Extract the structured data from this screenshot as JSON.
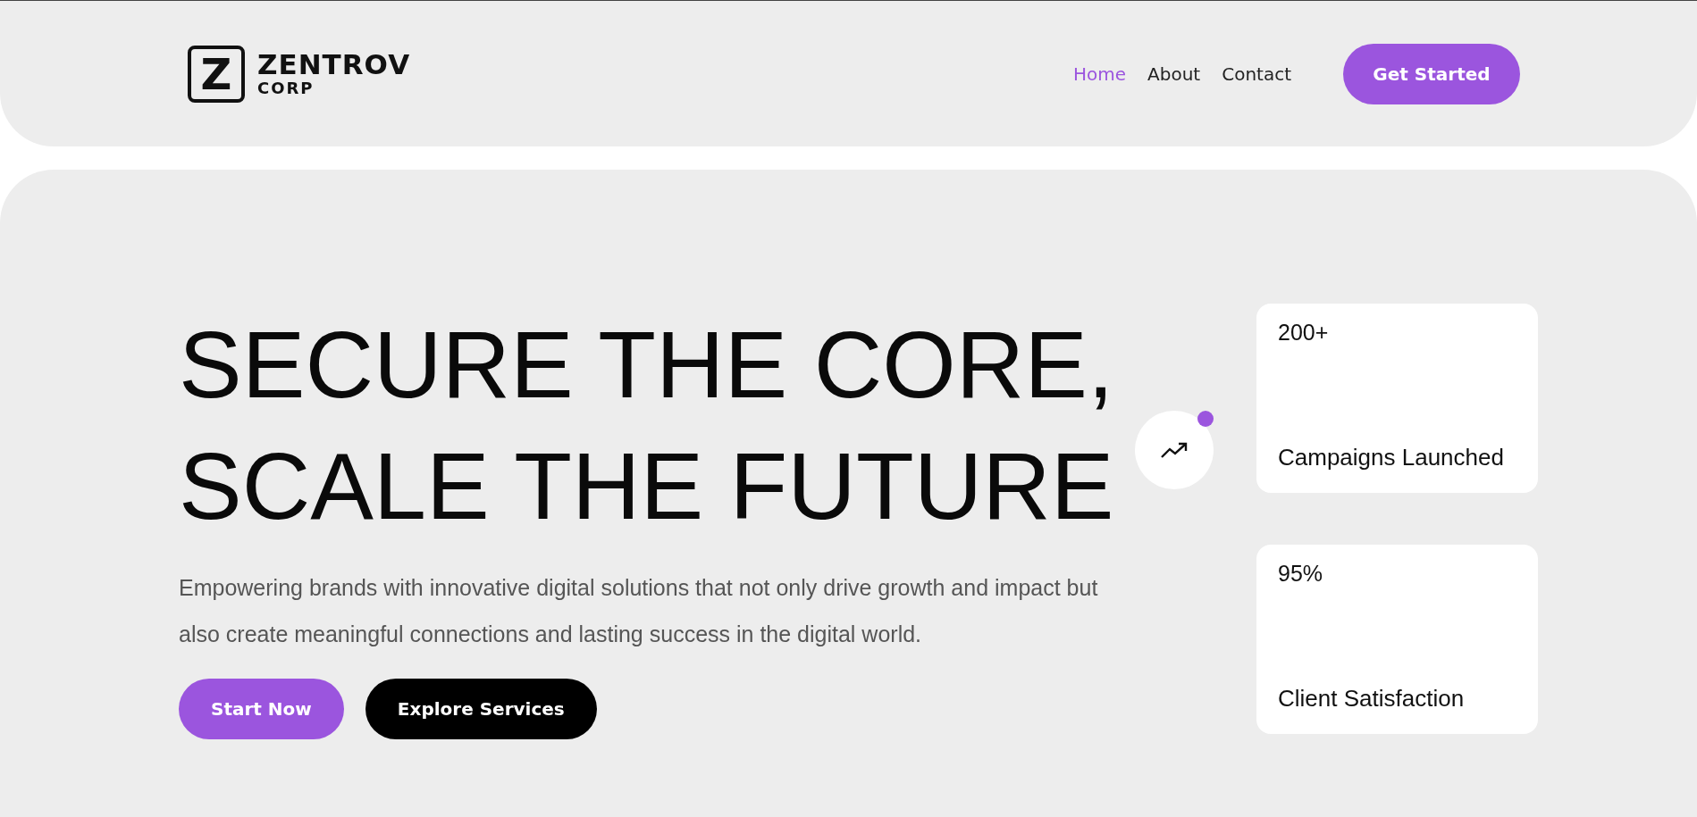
{
  "logo": {
    "letter": "Z",
    "name": "ZENTROV",
    "sub": "CORP"
  },
  "nav": [
    {
      "label": "Home",
      "selected": true
    },
    {
      "label": "About",
      "selected": false
    },
    {
      "label": "Contact",
      "selected": false
    }
  ],
  "cta": "Get Started",
  "hero": {
    "headline": [
      "SECURE THE CORE,",
      "SCALE THE FUTURE"
    ],
    "text": "Empowering brands with innovative digital solutions that not only drive growth and impact but also create meaningful connections and lasting success in the digital world.",
    "buttons": [
      {
        "label": "Start Now",
        "kind": "primary"
      },
      {
        "label": "Explore Services",
        "kind": "dark"
      }
    ]
  },
  "stats": [
    {
      "value": "200+",
      "label": "Campaigns Launched"
    },
    {
      "value": "95%",
      "label": "Client Satisfaction"
    }
  ]
}
